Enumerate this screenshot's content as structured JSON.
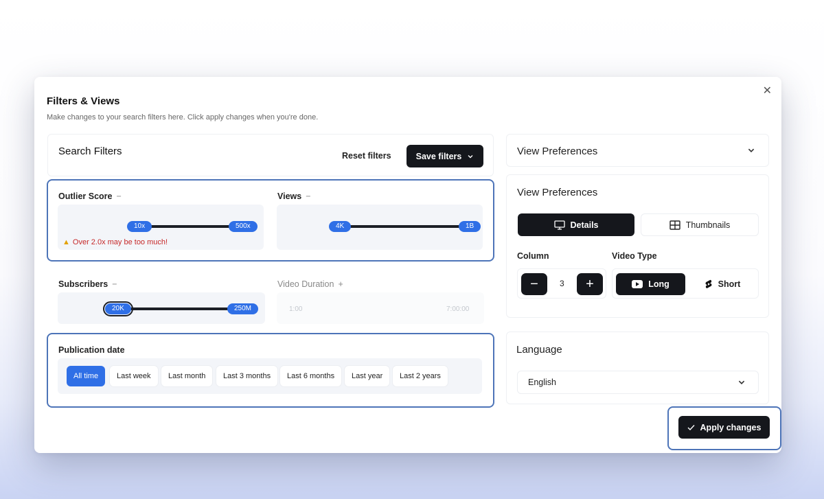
{
  "modal": {
    "title": "Filters & Views",
    "subtitle": "Make changes to your search filters here. Click apply changes when you're done."
  },
  "search_filters": {
    "title": "Search Filters",
    "reset_label": "Reset filters",
    "save_label": "Save filters",
    "outlier_score": {
      "label": "Outlier Score",
      "toggle": "−",
      "min": "10x",
      "max": "500x",
      "warning": "Over 2.0x may be too much!"
    },
    "views": {
      "label": "Views",
      "toggle": "−",
      "min": "4K",
      "max": "1B"
    },
    "subscribers": {
      "label": "Subscribers",
      "toggle": "−",
      "min": "20K",
      "max": "250M"
    },
    "video_duration": {
      "label": "Video Duration",
      "toggle": "+",
      "min": "1:00",
      "max": "7:00:00"
    },
    "publication_date": {
      "label": "Publication date",
      "options": [
        "All time",
        "Last week",
        "Last month",
        "Last 3 months",
        "Last 6 months",
        "Last year",
        "Last 2 years"
      ],
      "selected": "All time"
    }
  },
  "view_preferences": {
    "collapsed_title": "View Preferences",
    "title": "View Preferences",
    "layout": {
      "details_label": "Details",
      "thumbnails_label": "Thumbnails",
      "selected": "Details"
    },
    "column": {
      "label": "Column",
      "value": "3",
      "minus": "−",
      "plus": "+"
    },
    "video_type": {
      "label": "Video Type",
      "long_label": "Long",
      "short_label": "Short",
      "selected": "Long"
    }
  },
  "language": {
    "title": "Language",
    "value": "English"
  },
  "apply_label": "Apply changes",
  "colors": {
    "accent": "#2f6fe6",
    "dark": "#15171c",
    "focus_border": "#4d74b8",
    "warning": "#c62828"
  },
  "icons": {
    "close": "close-icon",
    "save_chevron": "chevron-down-icon",
    "warning": "warning-icon",
    "details": "monitor-icon",
    "thumbnails": "grid-icon",
    "long": "youtube-icon",
    "short": "shorts-icon",
    "apply": "check-icon"
  }
}
